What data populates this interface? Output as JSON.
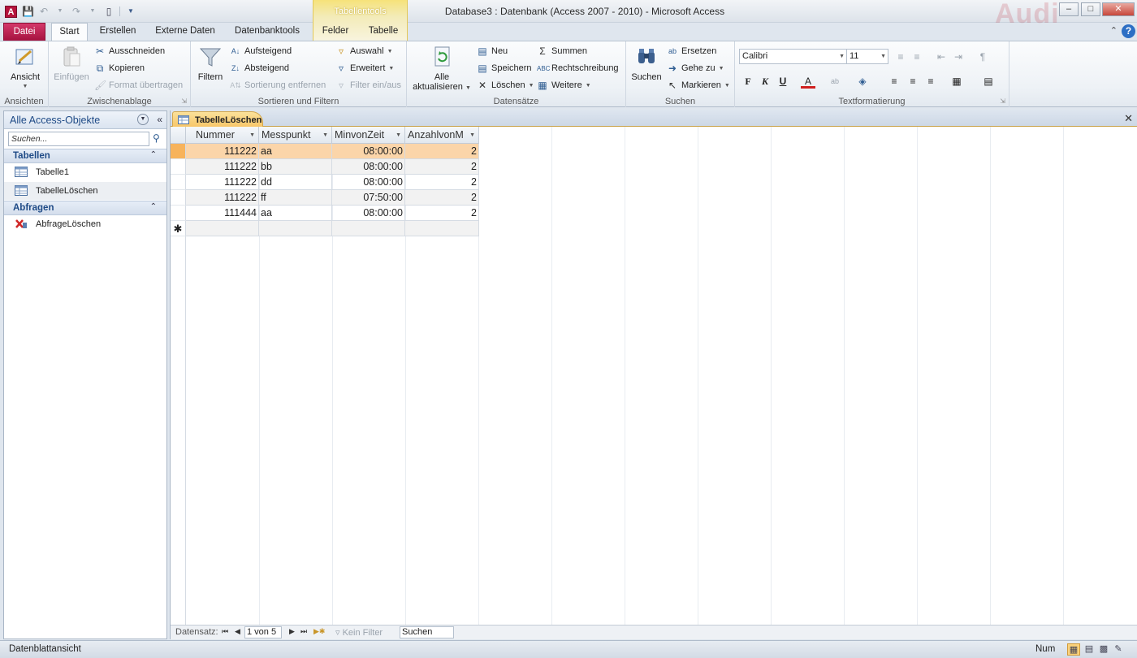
{
  "title_bar": {
    "window_title": "Database3 : Datenbank (Access 2007 - 2010)  -  Microsoft Access",
    "context_group": "Tabellentools",
    "brand_watermark": "Audi"
  },
  "tabs": {
    "file": "Datei",
    "start": "Start",
    "create": "Erstellen",
    "external": "Externe Daten",
    "dbtools": "Datenbanktools",
    "fields": "Felder",
    "table": "Tabelle"
  },
  "ribbon": {
    "views": {
      "label": "Ansichten",
      "view_btn": "Ansicht"
    },
    "clipboard": {
      "label": "Zwischenablage",
      "paste": "Einfügen",
      "cut": "Ausschneiden",
      "copy": "Kopieren",
      "format_painter": "Format übertragen"
    },
    "sort_filter": {
      "label": "Sortieren und Filtern",
      "filter": "Filtern",
      "ascending": "Aufsteigend",
      "descending": "Absteigend",
      "remove_sort": "Sortierung entfernen",
      "selection": "Auswahl",
      "advanced": "Erweitert",
      "toggle_filter": "Filter ein/aus"
    },
    "records": {
      "label": "Datensätze",
      "refresh_line1": "Alle",
      "refresh_line2": "aktualisieren",
      "new": "Neu",
      "save": "Speichern",
      "delete": "Löschen",
      "totals": "Summen",
      "spelling": "Rechtschreibung",
      "more": "Weitere"
    },
    "find": {
      "label": "Suchen",
      "find": "Suchen",
      "replace": "Ersetzen",
      "goto": "Gehe zu",
      "select": "Markieren"
    },
    "text_format": {
      "label": "Textformatierung",
      "font": "Calibri",
      "size": "11",
      "bold": "F",
      "italic": "K",
      "underline": "U"
    }
  },
  "nav_pane": {
    "title": "Alle Access-Objekte",
    "search_placeholder": "Suchen...",
    "groups": [
      {
        "label": "Tabellen",
        "items": [
          "Tabelle1",
          "TabelleLöschen"
        ]
      },
      {
        "label": "Abfragen",
        "items": [
          "AbfrageLöschen"
        ]
      }
    ]
  },
  "document": {
    "tab_label": "TabelleLöschen",
    "columns": [
      "Nummer",
      "Messpunkt",
      "MinvonZeit",
      "AnzahlvonM"
    ],
    "rows": [
      [
        "111222",
        "aa",
        "08:00:00",
        "2"
      ],
      [
        "111222",
        "bb",
        "08:00:00",
        "2"
      ],
      [
        "111222",
        "dd",
        "08:00:00",
        "2"
      ],
      [
        "111222",
        "ff",
        "07:50:00",
        "2"
      ],
      [
        "111444",
        "aa",
        "08:00:00",
        "2"
      ]
    ],
    "new_row_marker": "✱",
    "record_nav": {
      "label": "Datensatz:",
      "position": "1 von 5",
      "filter": "Kein Filter",
      "search": "Suchen"
    }
  },
  "status_bar": {
    "view_name": "Datenblattansicht",
    "num_lock": "Num"
  },
  "colors": {
    "accent_file_tab": "#a5123f",
    "selected_row": "#fbd5a9",
    "context_tab": "#f6e27a",
    "nav_group_text": "#1e4a86"
  }
}
